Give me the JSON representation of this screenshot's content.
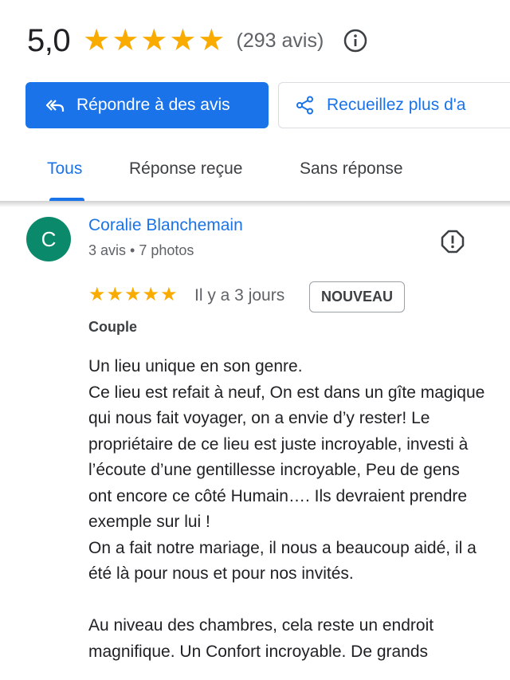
{
  "summary": {
    "rating": "5,0",
    "stars_filled": 5,
    "review_count": "(293 avis)",
    "star_color": "#f9ab00"
  },
  "actions": {
    "reply_label": "Répondre à des avis",
    "collect_label": "Recueillez plus d'a",
    "accent_color": "#1a73e8"
  },
  "tabs": [
    {
      "label": "Tous",
      "active": true
    },
    {
      "label": "Réponse reçue",
      "active": false
    },
    {
      "label": "Sans réponse",
      "active": false
    }
  ],
  "review": {
    "avatar_letter": "C",
    "avatar_color": "#0b8a6b",
    "author": "Coralie Blanchemain",
    "author_meta": "3 avis • 7 photos",
    "stars": 5,
    "time": "Il y a 3 jours",
    "badge": "NOUVEAU",
    "trip_type": "Couple",
    "text": "Un lieu unique en son genre.\nCe lieu est refait à neuf, On est dans un gîte magique qui nous fait voyager, on a envie d’y rester! Le propriétaire de ce lieu est juste incroyable, investi à l’écoute d’une gentillesse incroyable, Peu de gens ont encore ce côté Humain…. Ils devraient prendre exemple sur lui !\nOn a fait notre mariage, il nous a beaucoup aidé, il a été là pour nous et pour nos invités.\n\nAu niveau des chambres, cela reste un endroit magnifique. Un Confort incroyable. De grands"
  },
  "icons": {
    "info": "info-icon",
    "reply": "reply-all-icon",
    "share": "share-icon",
    "flag": "report-icon"
  }
}
